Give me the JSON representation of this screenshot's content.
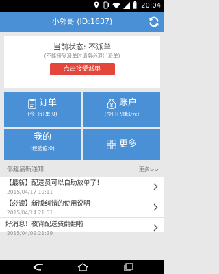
{
  "status_bar": {
    "time": "20:04",
    "icons": [
      "location-icon",
      "vibrate-icon",
      "wifi-icon",
      "signal-icon",
      "battery-icon"
    ]
  },
  "app_bar": {
    "title": "小邻哥 (ID:1637)",
    "refresh_icon": "refresh-icon",
    "color": "#4a90d6"
  },
  "status_card": {
    "state_text": "当前状态: 不派单",
    "hint_text": "(不能接受派单时请务必退出派单)",
    "accept_button": "点击接受派单",
    "button_color": "#e4463b"
  },
  "tiles": {
    "orders": {
      "label": "订单",
      "sub": "(今日订单:0)",
      "icon": "clipboard-icon"
    },
    "account": {
      "label": "账户",
      "sub": "(今日已赚:0元)",
      "icon": "money-bag-icon"
    },
    "mine": {
      "label": "我的",
      "sub": "(经验值:0)"
    },
    "more": {
      "label": "更多",
      "icon": "grid-icon"
    }
  },
  "notices_header": {
    "title": "邻趣最新通知",
    "more": "更多>>"
  },
  "notices": [
    {
      "title": "【最新】配送员可以自助放单了！",
      "date": "2015/04/17 10:11"
    },
    {
      "title": "【必读】新版纠错的使用说明",
      "date": "2015/04/14 21:51"
    },
    {
      "title": "好消息！夜宵配送费翻翻啦",
      "date": "2015/04/09 21:29"
    }
  ],
  "nav_bar": {
    "icons": [
      "back-icon",
      "home-icon",
      "recent-apps-icon"
    ]
  }
}
